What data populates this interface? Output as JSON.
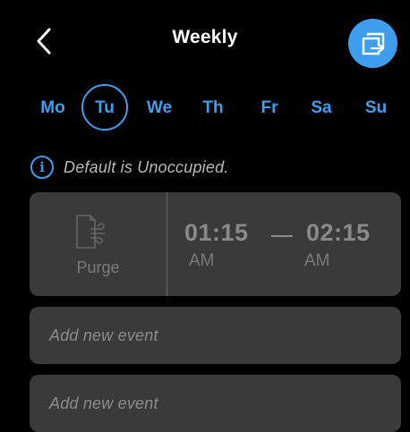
{
  "header": {
    "title": "Weekly",
    "back_icon": "chevron-left-icon",
    "copy_icon": "copy-schedule-icon",
    "accent_color": "#3d9ef0"
  },
  "days": {
    "items": [
      "Mo",
      "Tu",
      "We",
      "Th",
      "Fr",
      "Sa",
      "Su"
    ],
    "selected": "Tu"
  },
  "info": {
    "icon": "info-icon",
    "icon_glyph": "i",
    "text": "Default is Unoccupied."
  },
  "event": {
    "mode_icon": "purge-icon",
    "mode_label": "Purge",
    "start_time": "01:15",
    "start_period": "AM",
    "end_time": "02:15",
    "end_period": "AM"
  },
  "add_events": [
    {
      "label": "Add new event"
    },
    {
      "label": "Add new event"
    }
  ]
}
